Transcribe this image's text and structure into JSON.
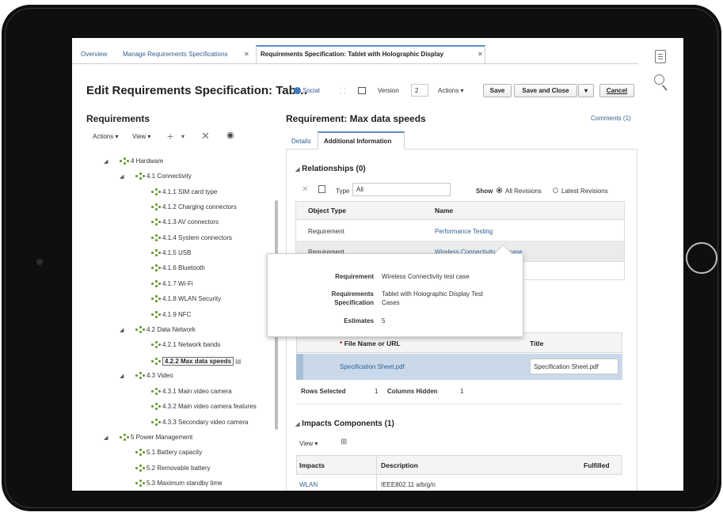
{
  "tabs": [
    {
      "label": "Overview"
    },
    {
      "label": "Manage Requirements Specifications"
    },
    {
      "label": "Requirements Specification: Tablet with Holographic Display"
    }
  ],
  "header": {
    "title": "Edit Requirements Specification: Tab…",
    "social": "Social",
    "version_label": "Version",
    "version_value": "2",
    "actions": "Actions",
    "save": "Save",
    "save_close": "Save and Close",
    "cancel": "Cancel"
  },
  "left": {
    "title": "Requirements",
    "toolbar": {
      "actions": "Actions",
      "view": "View"
    },
    "tree": [
      {
        "label": "4 Hardware"
      },
      {
        "label": "4.1 Connectivity"
      },
      {
        "label": "4.1.1 SIM card type"
      },
      {
        "label": "4.1.2 Charging connectors"
      },
      {
        "label": "4.1.3 AV connectors"
      },
      {
        "label": "4.1.4 System connectors"
      },
      {
        "label": "4.1.5 USB"
      },
      {
        "label": "4.1.6 Bluetooth"
      },
      {
        "label": "4.1.7 Wi-Fi"
      },
      {
        "label": "4.1.8 WLAN Security"
      },
      {
        "label": "4.1.9 NFC"
      },
      {
        "label": "4.2 Data Network"
      },
      {
        "label": "4.2.1 Network bands"
      },
      {
        "label": "4.2.2 Max data speeds"
      },
      {
        "label": "4.3 Video"
      },
      {
        "label": "4.3.1 Main video camera"
      },
      {
        "label": "4.3.2 Main video camera features"
      },
      {
        "label": "4.3.3 Secondary video camera"
      },
      {
        "label": "5 Power Management"
      },
      {
        "label": "5.1 Battery capacity"
      },
      {
        "label": "5.2 Removable battery"
      },
      {
        "label": "5.3 Maximum standby time"
      }
    ]
  },
  "right": {
    "title": "Requirement: Max data speeds",
    "comments": "Comments (1)",
    "subtabs": {
      "details": "Details",
      "additional": "Additional Information"
    },
    "relationships": {
      "title": "Relationships (0)",
      "type_label": "Type",
      "type_value": "All",
      "show_label": "Show",
      "opt_all": "All Revisions",
      "opt_latest": "Latest Revisions",
      "headers": {
        "object_type": "Object Type",
        "name": "Name"
      },
      "rows": [
        {
          "object_type": "Requirement",
          "name": "Performance Testing"
        },
        {
          "object_type": "Requirement",
          "name": "Wireless Connectivity test case"
        }
      ]
    },
    "popup": {
      "requirement_label": "Requirement",
      "requirement_value": "Wireless Connectivity test case",
      "spec_label_1": "Requirements",
      "spec_label_2": "Specification",
      "spec_value_1": "Tablet with Holographic Display Test",
      "spec_value_2": "Cases",
      "estimates_label": "Estimates",
      "estimates_value": "5"
    },
    "attachments": {
      "headers": {
        "file": "File Name or URL",
        "title": "Title"
      },
      "required_mark": "*",
      "row": {
        "file": "Specification Sheet.pdf",
        "title": "Specification Sheet.pdf"
      },
      "rows_selected_label": "Rows Selected",
      "rows_selected": "1",
      "columns_hidden_label": "Columns Hidden",
      "columns_hidden": "1"
    },
    "impacts": {
      "title": "Impacts Components (1)",
      "view": "View",
      "headers": {
        "impacts": "Impacts",
        "description": "Description",
        "fulfilled": "Fulfilled"
      },
      "row": {
        "impacts": "WLAN",
        "description": "IEEE802.11 a/b/g/n"
      }
    }
  },
  "colors": {
    "link": "#2f5f8f",
    "node_icon": "#6b9a3a",
    "selected_row": "#c9d9ea",
    "tablet": "#0f0f0f"
  }
}
